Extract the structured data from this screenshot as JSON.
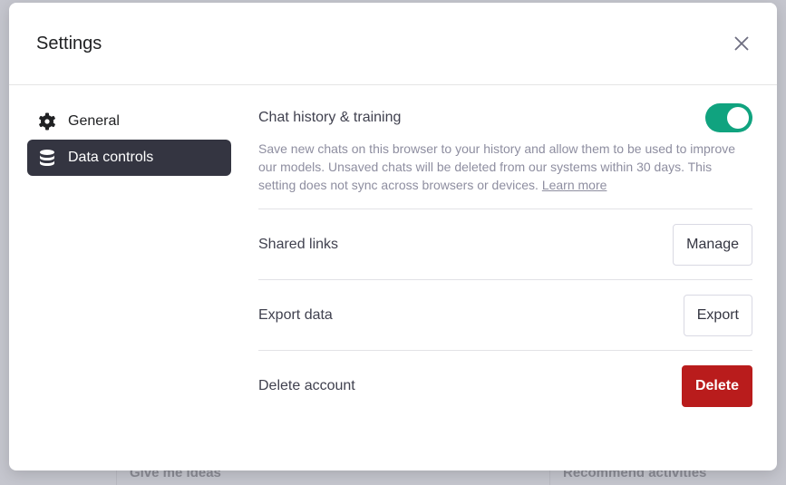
{
  "background": {
    "cards": [
      "Give me ideas",
      "Recommend activities"
    ]
  },
  "modal": {
    "title": "Settings",
    "nav": [
      {
        "label": "General",
        "icon": "gear-icon"
      },
      {
        "label": "Data controls",
        "icon": "database-icon",
        "active": true
      }
    ],
    "chat_history": {
      "label": "Chat history & training",
      "enabled": true,
      "description": "Save new chats on this browser to your history and allow them to be used to improve our models. Unsaved chats will be deleted from our systems within 30 days. This setting does not sync across browsers or devices.",
      "link": "Learn more"
    },
    "shared_links": {
      "label": "Shared links",
      "button": "Manage"
    },
    "export_data": {
      "label": "Export data",
      "button": "Export"
    },
    "delete_account": {
      "label": "Delete account",
      "button": "Delete"
    }
  },
  "colors": {
    "accent": "#10a37f",
    "danger": "#b91c1c",
    "active_nav": "#343541"
  }
}
